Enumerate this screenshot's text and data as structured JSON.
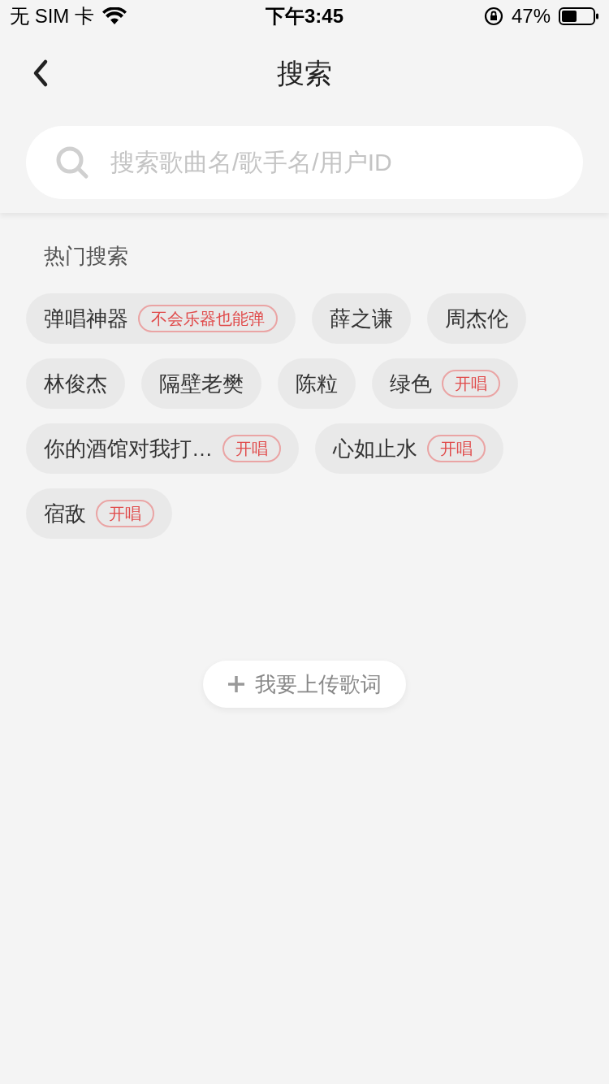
{
  "status_bar": {
    "carrier": "无 SIM 卡",
    "time": "下午3:45",
    "battery": "47%"
  },
  "nav": {
    "title": "搜索"
  },
  "search": {
    "placeholder": "搜索歌曲名/歌手名/用户ID"
  },
  "hot_search": {
    "title": "热门搜索",
    "tags": [
      {
        "label": "弹唱神器",
        "badge": "不会乐器也能弹"
      },
      {
        "label": "薛之谦"
      },
      {
        "label": "周杰伦"
      },
      {
        "label": "林俊杰"
      },
      {
        "label": "隔壁老樊"
      },
      {
        "label": "陈粒"
      },
      {
        "label": "绿色",
        "badge": "开唱"
      },
      {
        "label": "你的酒馆对我打…",
        "badge": "开唱"
      },
      {
        "label": "心如止水",
        "badge": "开唱"
      },
      {
        "label": "宿敌",
        "badge": "开唱"
      }
    ]
  },
  "upload_button": {
    "label": "我要上传歌词"
  }
}
